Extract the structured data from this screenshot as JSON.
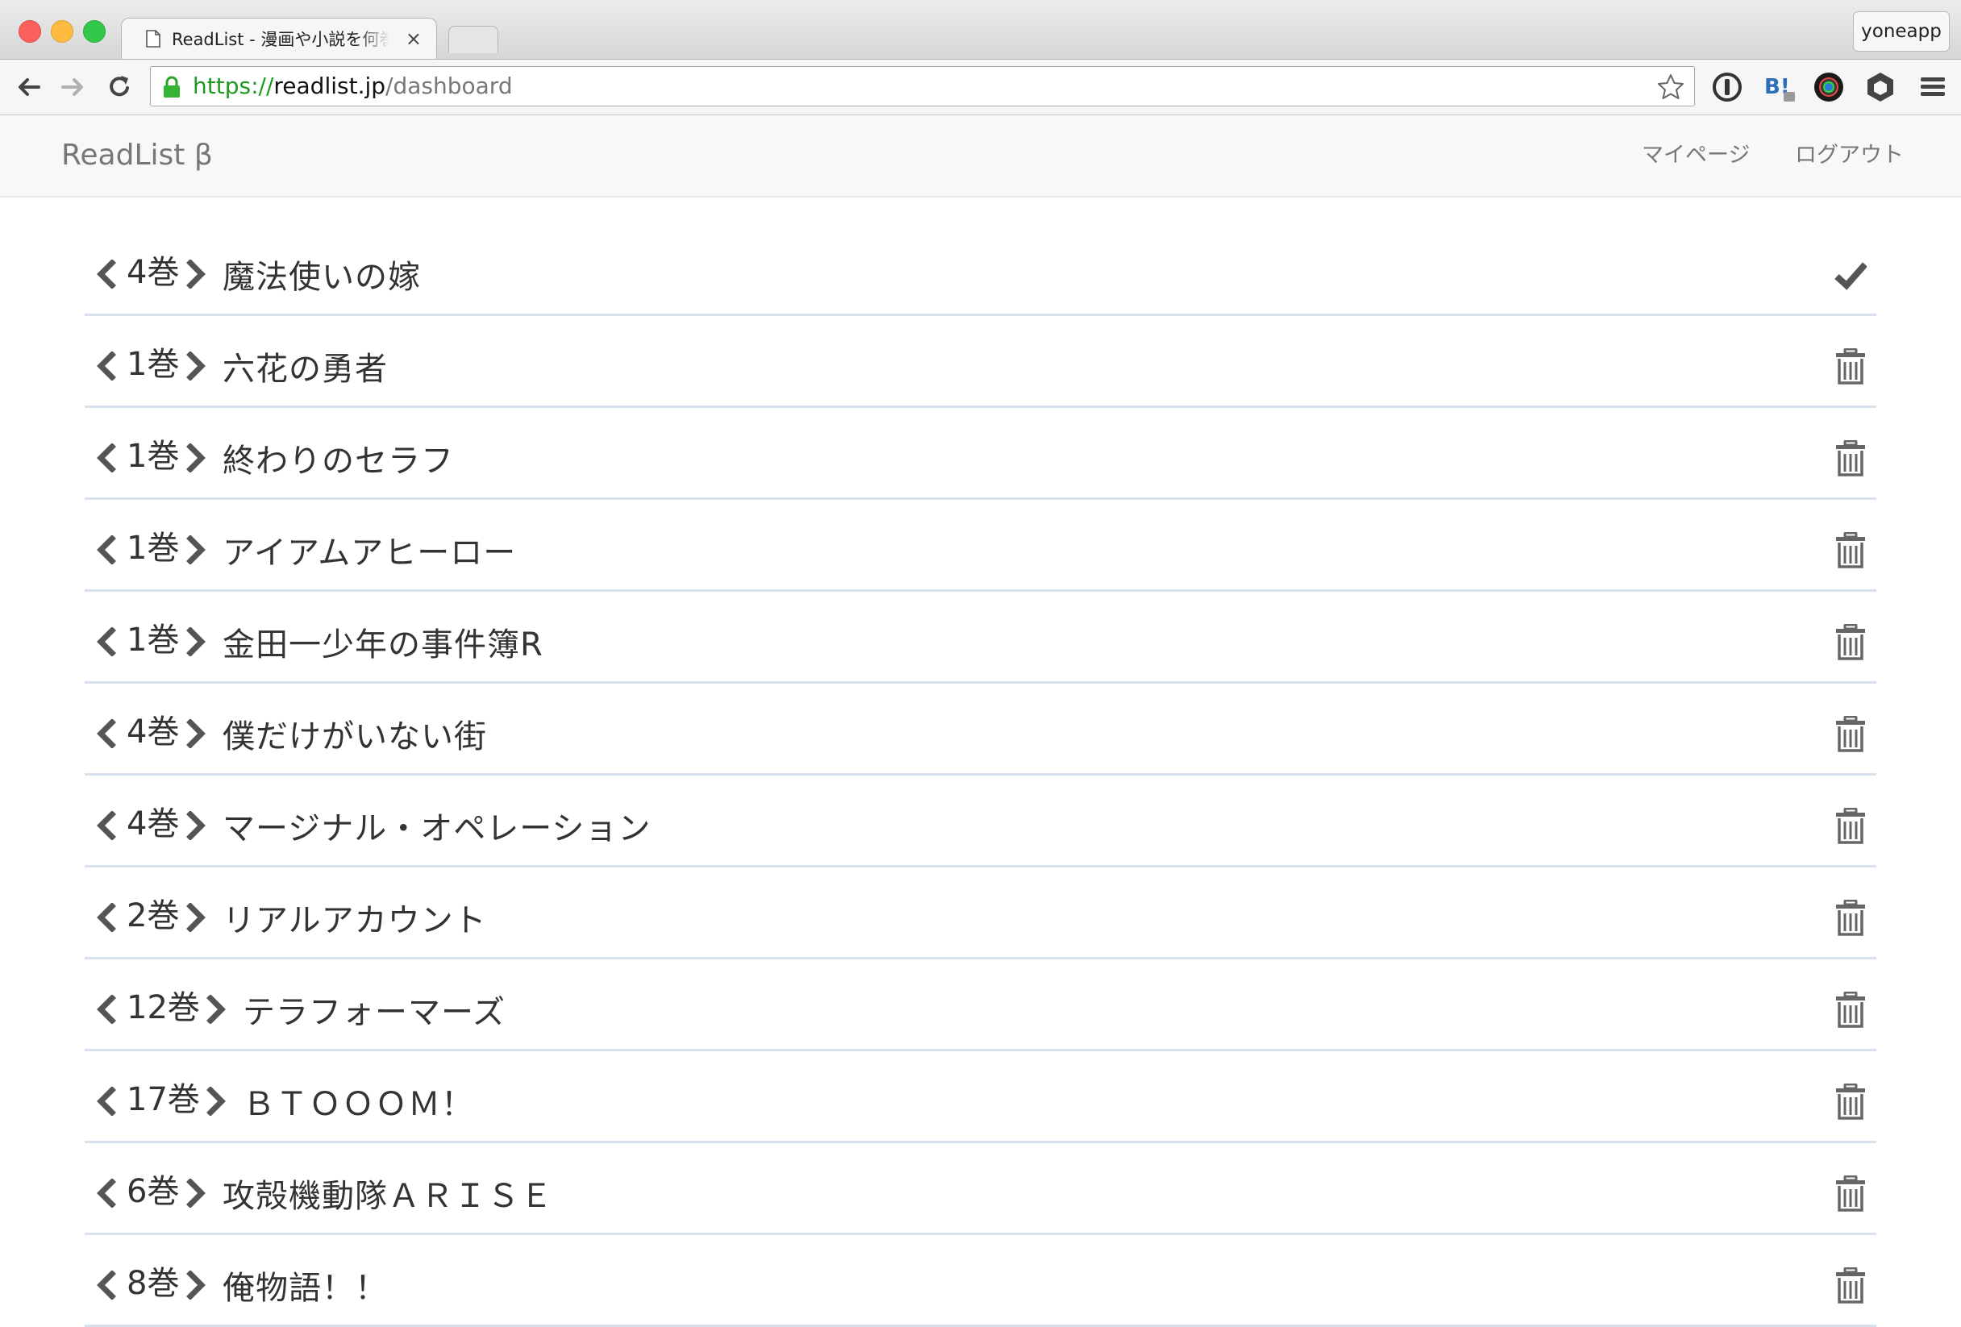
{
  "browser": {
    "tab_title": "ReadList - 漫画や小説を何巻まで読んだか",
    "tab_close": "×",
    "user_name": "yoneapp",
    "url": {
      "scheme": "https",
      "separator": "://",
      "host": "readlist.jp",
      "path": "/dashboard"
    }
  },
  "navbar": {
    "brand": "ReadList β",
    "links": {
      "mypage": "マイページ",
      "logout": "ログアウト"
    }
  },
  "list": [
    {
      "volume": "4巻",
      "title": "魔法使いの嫁",
      "action": "checkmark-icon"
    },
    {
      "volume": "1巻",
      "title": "六花の勇者",
      "action": "trash-icon"
    },
    {
      "volume": "1巻",
      "title": "終わりのセラフ",
      "action": "trash-icon"
    },
    {
      "volume": "1巻",
      "title": "アイアムアヒーロー",
      "action": "trash-icon"
    },
    {
      "volume": "1巻",
      "title": "金田一少年の事件簿R",
      "action": "trash-icon"
    },
    {
      "volume": "4巻",
      "title": "僕だけがいない街",
      "action": "trash-icon"
    },
    {
      "volume": "4巻",
      "title": "マージナル・オペレーション",
      "action": "trash-icon"
    },
    {
      "volume": "2巻",
      "title": "リアルアカウント",
      "action": "trash-icon"
    },
    {
      "volume": "12巻",
      "title": "テラフォーマーズ",
      "action": "trash-icon"
    },
    {
      "volume": "17巻",
      "title": "ＢＴＯＯＯＭ！",
      "action": "trash-icon"
    },
    {
      "volume": "6巻",
      "title": "攻殻機動隊ＡＲＩＳＥ",
      "action": "trash-icon"
    },
    {
      "volume": "8巻",
      "title": "俺物語！！",
      "action": "trash-icon"
    }
  ],
  "colors": {
    "accent_green": "#1d9a1d",
    "muted_text": "#777777",
    "row_border": "#d7e0ec"
  }
}
